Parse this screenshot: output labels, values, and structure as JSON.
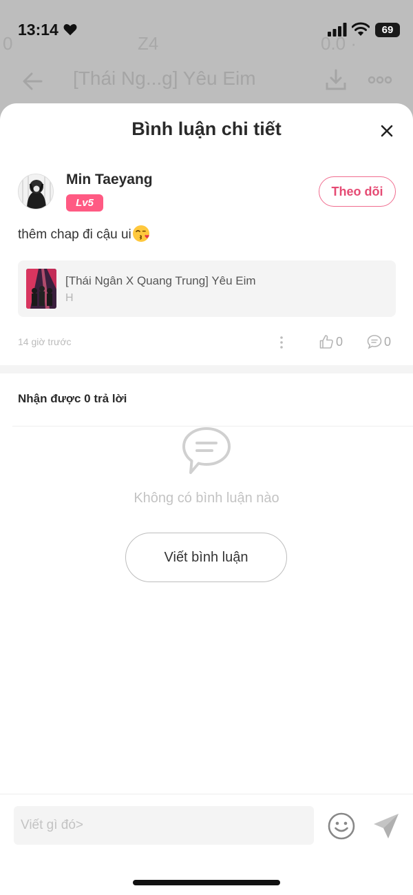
{
  "status_bar": {
    "time": "13:14",
    "battery": "69"
  },
  "background": {
    "title": "[Thái Ng...g] Yêu Eim",
    "faint_left": "0",
    "faint_mid": "Z4",
    "faint_right": "0.0 ·"
  },
  "sheet": {
    "title": "Bình luận chi tiết"
  },
  "comment": {
    "username": "Min Taeyang",
    "level": "Lv5",
    "follow_label": "Theo dõi",
    "text": "thêm chap đi cậu ui",
    "time_ago": "14 giờ trước",
    "like_count": "0",
    "reply_count": "0"
  },
  "story": {
    "title": "[Thái Ngân X Quang Trung] Yêu Eim",
    "subtitle": "H"
  },
  "replies": {
    "header": "Nhận được 0 trả lời",
    "empty_text": "Không có bình luận nào",
    "write_button": "Viết bình luận"
  },
  "input": {
    "placeholder": "Viết gì đó>"
  },
  "colors": {
    "accent": "#ff5a83",
    "follow_border": "#f06b8e",
    "muted": "#c3c3c3"
  }
}
